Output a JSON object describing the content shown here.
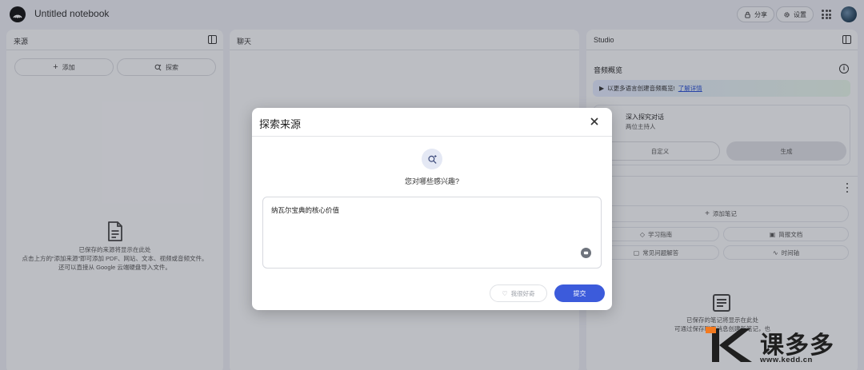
{
  "app": {
    "title": "Untitled notebook",
    "share_label": "分享",
    "settings_label": "设置"
  },
  "sources_panel": {
    "title": "来源",
    "add_label": "添加",
    "discover_label": "探索",
    "empty_line1": "已保存的来源将显示在此处",
    "empty_line2": "点击上方的“添加来源”即可添加 PDF、网站、文本、视频或音频文件。",
    "empty_line3": "还可以直接从 Google 云端硬盘导入文件。"
  },
  "chat_panel": {
    "title": "聊天"
  },
  "studio_panel": {
    "title": "Studio",
    "audio_overview_title": "音频概览",
    "banner_text": "以更多语言创建音频概览!",
    "banner_link": "了解详情",
    "deep_dive_title": "深入探究对话",
    "deep_dive_subtitle": "两位主持人",
    "customize_label": "自定义",
    "generate_label": "生成",
    "add_note_label": "添加笔记",
    "study_guide_label": "学习指南",
    "briefing_doc_label": "简报文档",
    "faq_label": "常见问题解答",
    "timeline_label": "时间轴",
    "notes_empty_line1": "已保存的笔记将显示在此处",
    "notes_empty_line2": "可通过保存聊天消息创建新笔记，也"
  },
  "modal": {
    "title": "探索来源",
    "question": "您对哪些感兴趣?",
    "input_value": "纳瓦尔宝典的核心价值",
    "lucky_label": "我很好奇",
    "submit_label": "提交"
  },
  "watermark": {
    "brand": "课多多",
    "url": "www.kedd.cn"
  },
  "colors": {
    "accent": "#3c5bdb",
    "background": "#e9ebf1",
    "panel": "#f6f7f9"
  }
}
